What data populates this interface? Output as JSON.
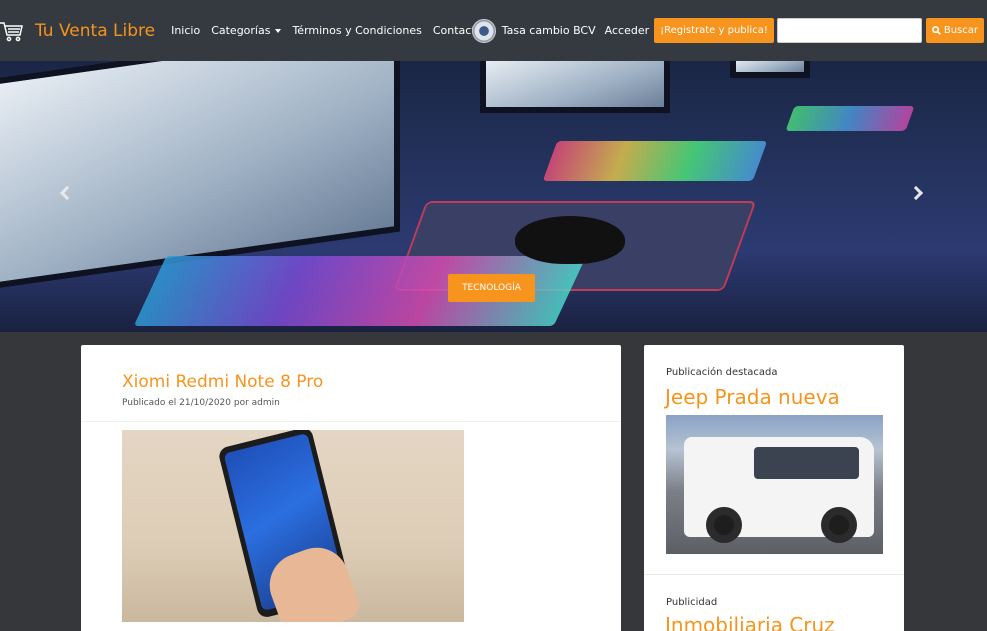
{
  "navbar": {
    "brand": "Tu Venta Libre",
    "links": [
      "Inicio",
      "Categorías",
      "Términos y Condiciones",
      "Contacto"
    ],
    "bcv_label": "Tasa cambio BCV",
    "login_label": "Acceder",
    "register_label": "¡Registrate y publica!",
    "search_value": "",
    "search_button": "Buscar"
  },
  "hero": {
    "badge": "TECNOLOGÍA"
  },
  "post": {
    "title": "Xiomi Redmi Note 8 Pro",
    "meta": "Publicado el 21/10/2020 por admin"
  },
  "sidebar": {
    "featured_label": "Publicación destacada",
    "featured_title": "Jeep Prada nueva",
    "ad_label": "Publicidad",
    "ad_title": "Inmobiliaria Cruz"
  },
  "colors": {
    "accent": "#f7941d",
    "navbar_bg": "#343a40",
    "page_bg": "#36373b"
  },
  "icons": [
    "cart-icon",
    "chevron-down-icon",
    "bcv-seal-icon",
    "search-icon",
    "chevron-left-icon",
    "chevron-right-icon"
  ]
}
